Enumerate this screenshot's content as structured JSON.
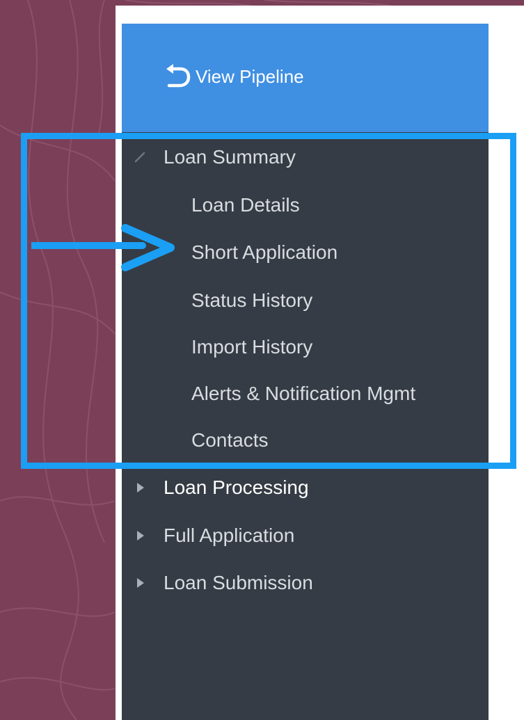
{
  "sidebar": {
    "view_pipeline_label": "View Pipeline",
    "sections": [
      {
        "label": "Loan Summary",
        "expanded": true,
        "items": [
          {
            "label": "Loan Details"
          },
          {
            "label": "Short Application"
          },
          {
            "label": "Status History"
          },
          {
            "label": "Import History"
          },
          {
            "label": "Alerts & Notification Mgmt"
          },
          {
            "label": "Contacts"
          }
        ]
      },
      {
        "label": "Loan Processing",
        "expanded": false
      },
      {
        "label": "Full Application",
        "expanded": false
      },
      {
        "label": "Loan Submission",
        "expanded": false
      }
    ]
  },
  "icons": {
    "back": "undo-arrow-icon",
    "expanded": "caret-expanded-icon",
    "collapsed": "caret-right-icon"
  },
  "colors": {
    "background": "#7c3f58",
    "sidebar": "#363c45",
    "pipeline_bar": "#3f8fe3",
    "highlight": "#1a9ff4",
    "nav_text": "#d9dde2"
  }
}
